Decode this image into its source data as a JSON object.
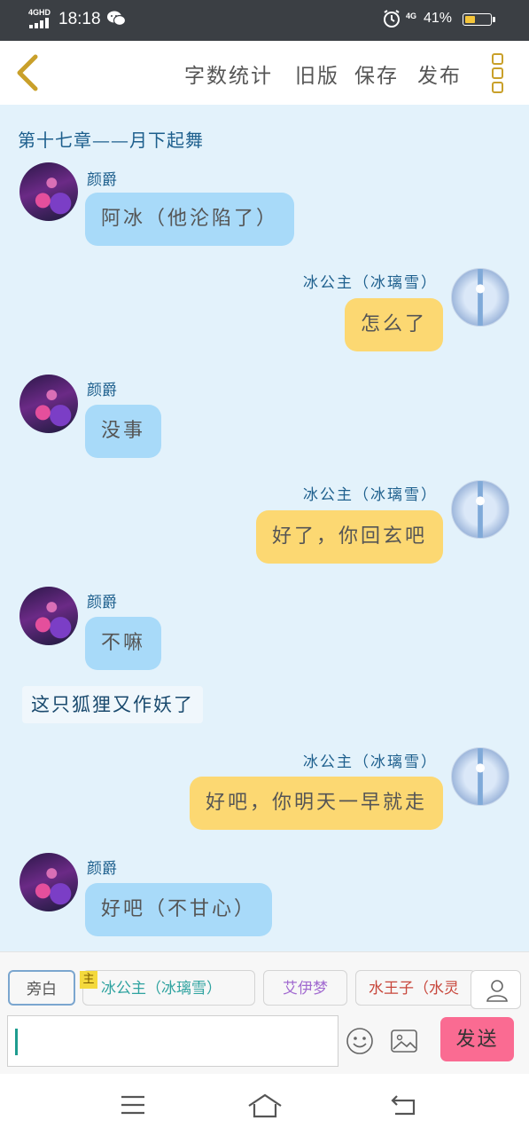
{
  "status_bar": {
    "network": "4GHD",
    "time": "18:18",
    "mobile_data": "4G",
    "battery_text": "41%",
    "battery_level": 0.41,
    "battery_color": "#f4c53a",
    "notification_icon": "wechat-icon",
    "alarm_icon": "alarm-icon"
  },
  "toolbar": {
    "back_icon": "chevron-left-icon",
    "items": [
      "字数统计",
      "旧版",
      "保存",
      "发布"
    ],
    "more_icon": "more-vertical-icon"
  },
  "chapter": {
    "title": "第十七章——月下起舞"
  },
  "messages": [
    {
      "side": "left",
      "speaker": "颜爵",
      "text": "阿冰（他沦陷了）"
    },
    {
      "side": "right",
      "speaker": "冰公主（冰璃雪）",
      "text": "怎么了"
    },
    {
      "side": "left",
      "speaker": "颜爵",
      "text": "没事"
    },
    {
      "side": "right",
      "speaker": "冰公主（冰璃雪）",
      "text": "好了，你回玄吧"
    },
    {
      "side": "left",
      "speaker": "颜爵",
      "text": "不嘛"
    },
    {
      "side": "narration",
      "text": "这只狐狸又作妖了"
    },
    {
      "side": "right",
      "speaker": "冰公主（冰璃雪）",
      "text": "好吧，你明天一早就走"
    },
    {
      "side": "left",
      "speaker": "颜爵",
      "text": "好吧（不甘心）"
    }
  ],
  "roles": {
    "narration_label": "旁白",
    "main_badge": "主",
    "items": [
      {
        "label": "冰公主（冰璃雪）",
        "color": "#2fa3a0"
      },
      {
        "label": "艾伊梦",
        "color": "#a26bd0"
      },
      {
        "label": "水王子（水灵",
        "color": "#c8473c"
      }
    ],
    "add_role_icon": "person-icon"
  },
  "composer": {
    "input_value": "",
    "emoji_icon": "emoji-icon",
    "image_icon": "image-icon",
    "send_label": "发送",
    "send_color": "#fa6b92"
  },
  "nav_bar": {
    "icons": [
      "menu-icon",
      "home-icon",
      "back-icon"
    ]
  }
}
